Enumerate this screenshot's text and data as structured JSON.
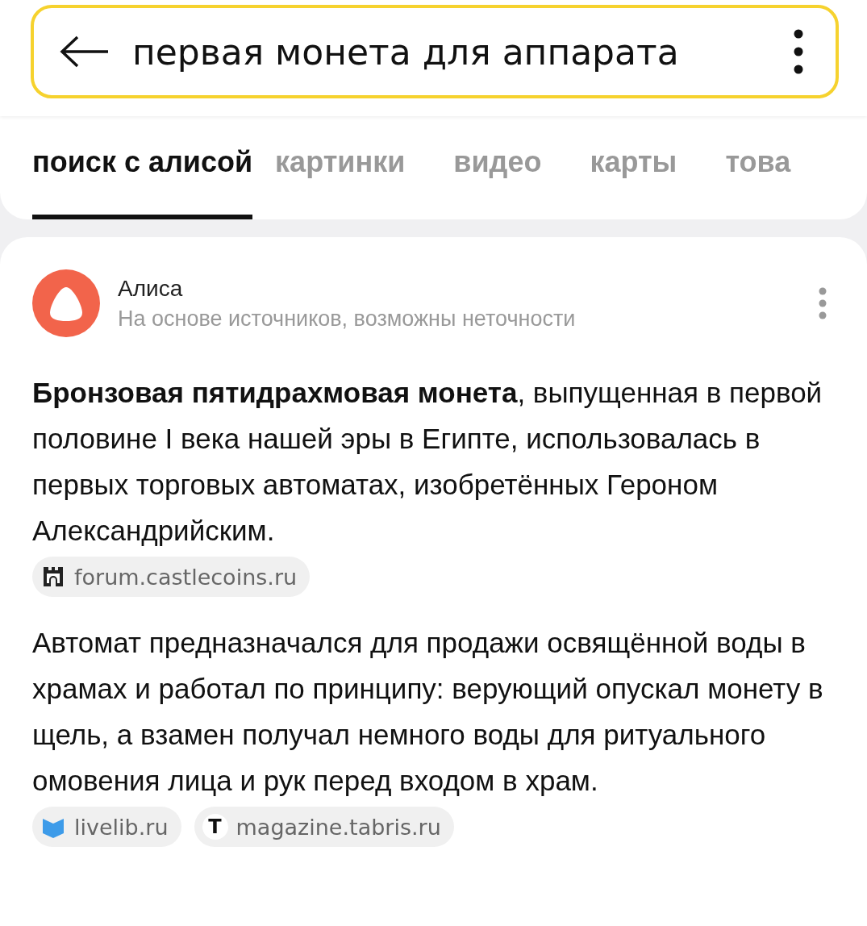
{
  "search": {
    "value": "первая монета для аппарата"
  },
  "tabs": [
    {
      "label": "поиск с алисой",
      "selected": true
    },
    {
      "label": "картинки",
      "selected": false
    },
    {
      "label": "видео",
      "selected": false
    },
    {
      "label": "карты",
      "selected": false
    },
    {
      "label": "това",
      "selected": false
    }
  ],
  "answer": {
    "author": "Алиса",
    "note": "На основе источников, возможны неточности",
    "blocks": [
      {
        "text": "**Бронзовая пятидрахмовая монета**, выпущенная в первой половине I века нашей эры в Египте, использовалась в первых торговых автоматах, изобретённых Героном Александрийским.",
        "sources": [
          {
            "kind": "castle",
            "label": "forum.castlecoins.ru"
          }
        ]
      },
      {
        "text": "Автомат предназначался для продажи освящённой воды в храмах и работал по принципу: верующий опускал монету в щель, а взамен получал немного воды для ритуального омовения лица и рук перед входом в храм.",
        "sources": [
          {
            "kind": "book",
            "label": "livelib.ru"
          },
          {
            "kind": "letter",
            "letter": "T",
            "label": "magazine.tabris.ru"
          }
        ]
      }
    ]
  }
}
